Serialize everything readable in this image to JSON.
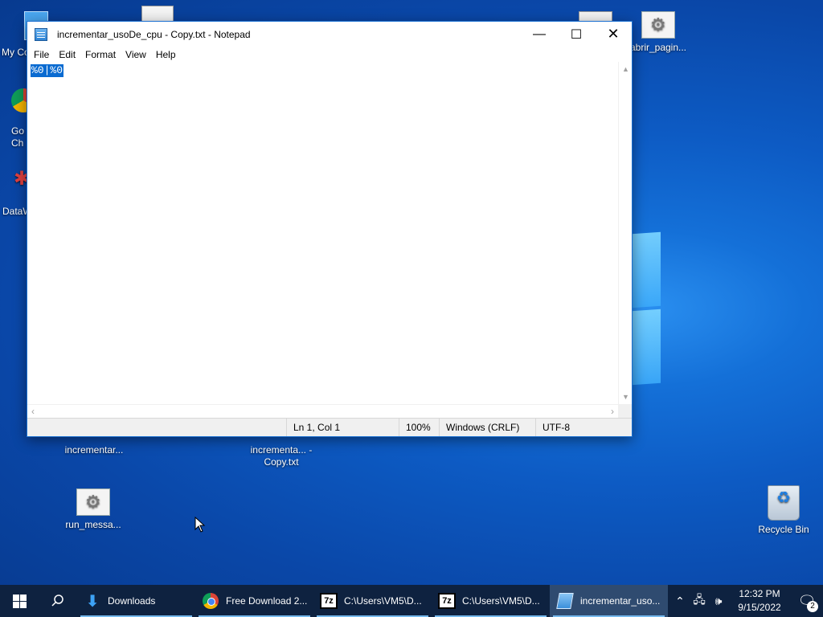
{
  "desktop": {
    "icons": [
      {
        "label": "My Co",
        "name": "my-computer"
      },
      {
        "label": "Go Ch",
        "name": "google-chrome"
      },
      {
        "label": "DataW",
        "name": "datawarehouse"
      },
      {
        "label": "abrir_pagin...",
        "name": "abrir-pagina"
      },
      {
        "label": "incrementar...",
        "name": "incrementar"
      },
      {
        "label": "incrementa... - Copy.txt",
        "name": "incrementar-copy"
      },
      {
        "label": "run_messa...",
        "name": "run-message"
      },
      {
        "label": "Recycle Bin",
        "name": "recycle-bin"
      }
    ]
  },
  "notepad": {
    "title": "incrementar_usoDe_cpu - Copy.txt - Notepad",
    "menu": [
      "File",
      "Edit",
      "Format",
      "View",
      "Help"
    ],
    "content_selected": "%0|%0",
    "status": {
      "position": "Ln 1, Col 1",
      "zoom": "100%",
      "line_ending": "Windows (CRLF)",
      "encoding": "UTF-8"
    }
  },
  "taskbar": {
    "items": [
      {
        "label": "Downloads",
        "icon": "downloads-folder-icon"
      },
      {
        "label": "Free Download 2...",
        "icon": "chrome-icon"
      },
      {
        "label": "C:\\Users\\VM5\\D...",
        "icon": "7zip-icon"
      },
      {
        "label": "C:\\Users\\VM5\\D...",
        "icon": "7zip-icon"
      },
      {
        "label": "incrementar_uso...",
        "icon": "notepad-icon"
      }
    ],
    "clock_time": "12:32 PM",
    "clock_date": "9/15/2022",
    "notification_count": "2"
  }
}
